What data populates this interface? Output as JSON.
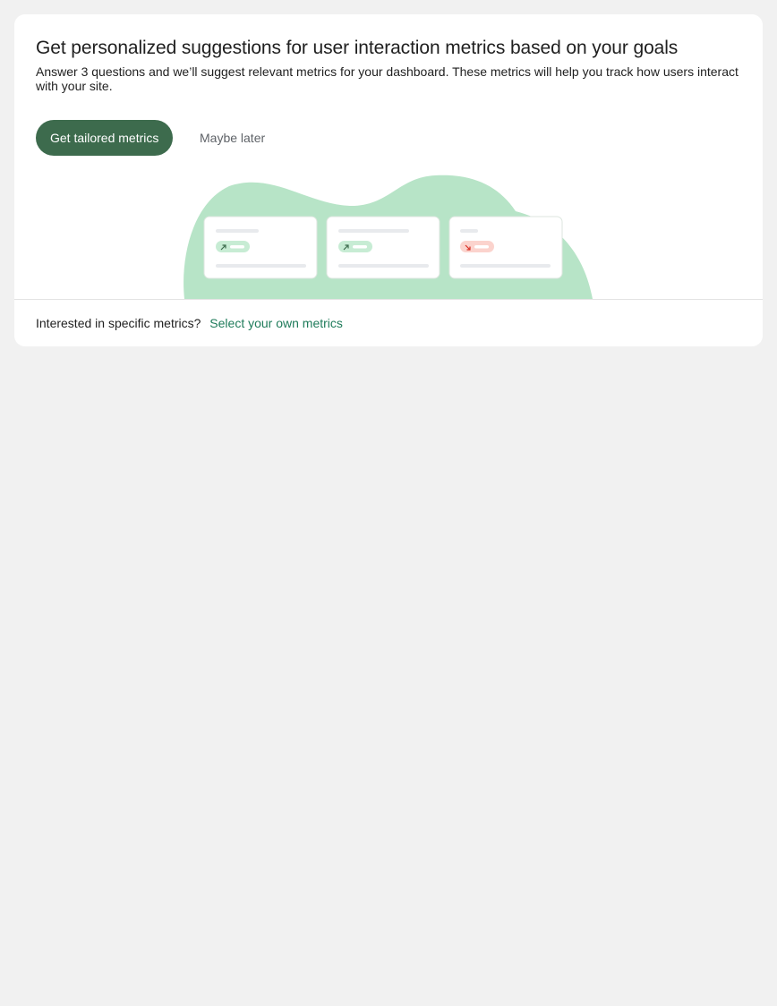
{
  "card": {
    "title": "Get personalized suggestions for user interaction metrics based on your goals",
    "description": "Answer 3 questions and we’ll suggest relevant metrics for your dashboard. These metrics will help you track how users interact with your site.",
    "primary_button_label": "Get tailored metrics",
    "secondary_button_label": "Maybe later"
  },
  "illustration": {
    "icons": [
      "trend-up-icon",
      "trend-up-icon",
      "trend-down-icon"
    ],
    "colors": {
      "blob": "#b7e4c7",
      "positive": "#c7ecd4",
      "negative": "#fbd3cd",
      "placeholder": "#e8eaed"
    }
  },
  "footer": {
    "label": "Interested in specific metrics?",
    "link_label": "Select your own metrics"
  },
  "colors": {
    "primary": "#3d6b4d",
    "link": "#1e7b5a",
    "background": "#f1f1f1"
  }
}
